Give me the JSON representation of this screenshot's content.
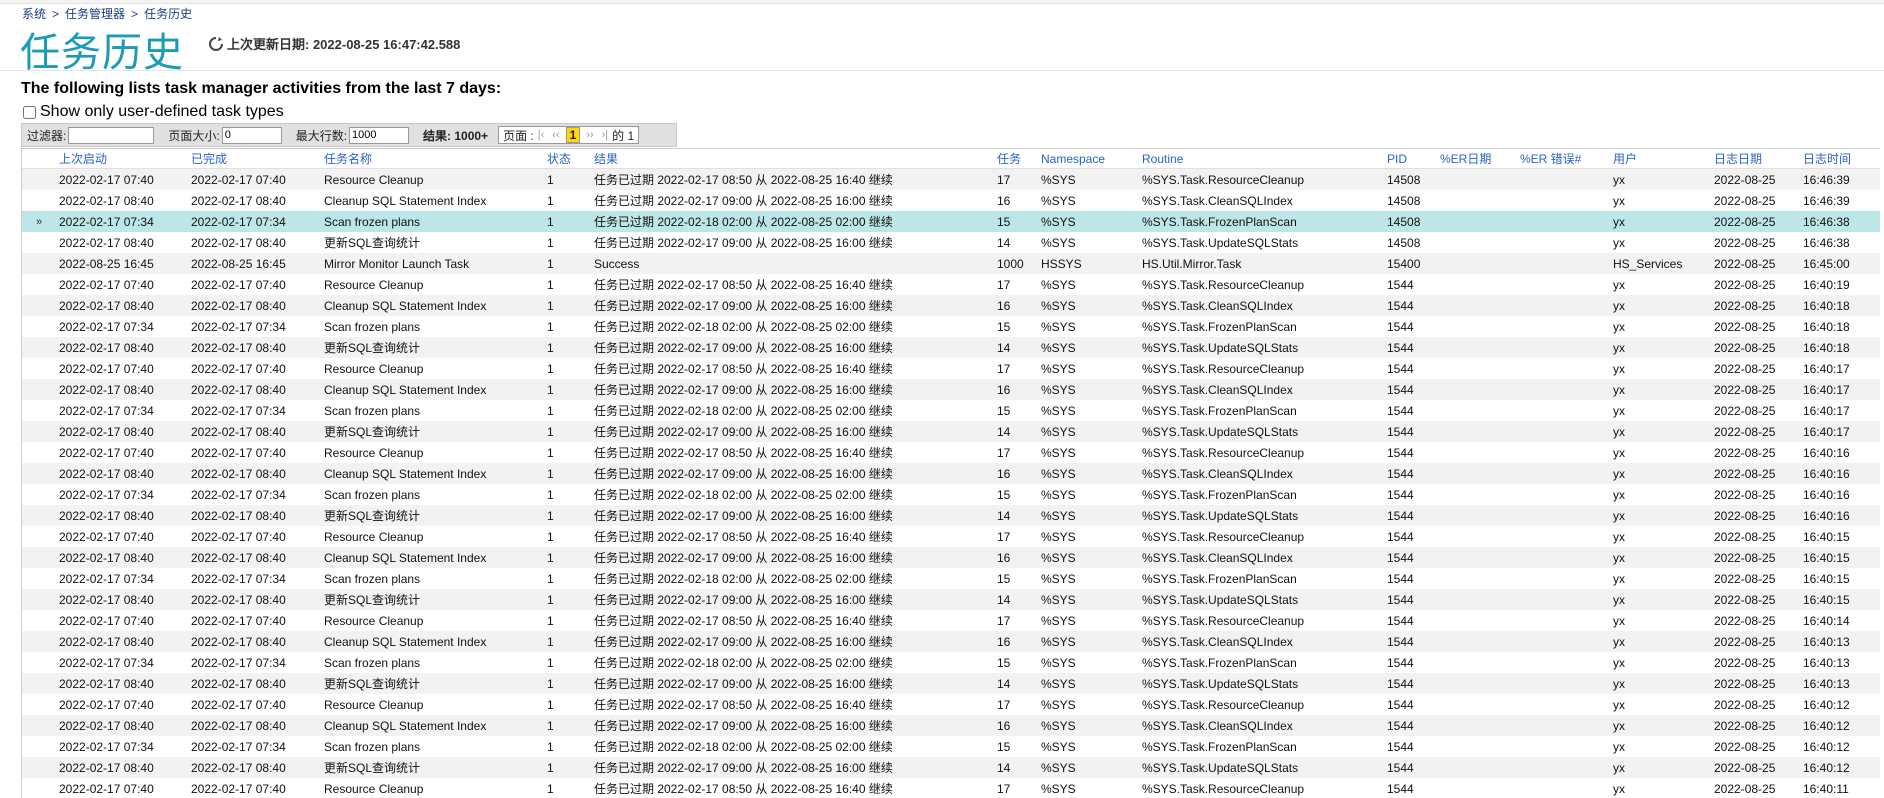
{
  "breadcrumb": {
    "system": "系统",
    "task_manager": "任务管理器",
    "current": "任务历史",
    "separator": ">"
  },
  "page_title": "任务历史",
  "refresh": {
    "label": "上次更新日期: 2022-08-25 16:47:42.588"
  },
  "intro": "The following lists task manager activities from the last 7 days:",
  "user_defined_checkbox": {
    "label": "Show only user-defined task types",
    "checked": false
  },
  "toolbar": {
    "filter_label": "过滤器:",
    "filter_value": "",
    "page_size_label": "页面大小:",
    "page_size_value": "0",
    "max_rows_label": "最大行数:",
    "max_rows_value": "1000",
    "results_label": "结果: 1000+",
    "page_label": "页面 :",
    "first": "|‹",
    "prev": "‹‹",
    "current_page": "1",
    "next": "››",
    "last": "›|",
    "of_total": "的 1"
  },
  "columns": [
    "上次启动",
    "已完成",
    "任务名称",
    "状态",
    "结果",
    "任务",
    "Namespace",
    "Routine",
    "PID",
    "%ER日期",
    "%ER 错误#",
    "用户",
    "日志日期",
    "日志时间"
  ],
  "selected_marker": "»",
  "rows": [
    [
      "2022-02-17 07:40",
      "2022-02-17 07:40",
      "Resource Cleanup",
      "1",
      "任务已过期 2022-02-17 08:50 从 2022-08-25 16:40 继续",
      "17",
      "%SYS",
      "%SYS.Task.ResourceCleanup",
      "14508",
      "",
      "",
      "yx",
      "2022-08-25",
      "16:46:39"
    ],
    [
      "2022-02-17 08:40",
      "2022-02-17 08:40",
      "Cleanup SQL Statement Index",
      "1",
      "任务已过期 2022-02-17 09:00 从 2022-08-25 16:00 继续",
      "16",
      "%SYS",
      "%SYS.Task.CleanSQLIndex",
      "14508",
      "",
      "",
      "yx",
      "2022-08-25",
      "16:46:39"
    ],
    [
      "2022-02-17 07:34",
      "2022-02-17 07:34",
      "Scan frozen plans",
      "1",
      "任务已过期 2022-02-18 02:00 从 2022-08-25 02:00 继续",
      "15",
      "%SYS",
      "%SYS.Task.FrozenPlanScan",
      "14508",
      "",
      "",
      "yx",
      "2022-08-25",
      "16:46:38"
    ],
    [
      "2022-02-17 08:40",
      "2022-02-17 08:40",
      "更新SQL查询统计",
      "1",
      "任务已过期 2022-02-17 09:00 从 2022-08-25 16:00 继续",
      "14",
      "%SYS",
      "%SYS.Task.UpdateSQLStats",
      "14508",
      "",
      "",
      "yx",
      "2022-08-25",
      "16:46:38"
    ],
    [
      "2022-08-25 16:45",
      "2022-08-25 16:45",
      "Mirror Monitor Launch Task",
      "1",
      "Success",
      "1000",
      "HSSYS",
      "HS.Util.Mirror.Task",
      "15400",
      "",
      "",
      "HS_Services",
      "2022-08-25",
      "16:45:00"
    ],
    [
      "2022-02-17 07:40",
      "2022-02-17 07:40",
      "Resource Cleanup",
      "1",
      "任务已过期 2022-02-17 08:50 从 2022-08-25 16:40 继续",
      "17",
      "%SYS",
      "%SYS.Task.ResourceCleanup",
      "1544",
      "",
      "",
      "yx",
      "2022-08-25",
      "16:40:19"
    ],
    [
      "2022-02-17 08:40",
      "2022-02-17 08:40",
      "Cleanup SQL Statement Index",
      "1",
      "任务已过期 2022-02-17 09:00 从 2022-08-25 16:00 继续",
      "16",
      "%SYS",
      "%SYS.Task.CleanSQLIndex",
      "1544",
      "",
      "",
      "yx",
      "2022-08-25",
      "16:40:18"
    ],
    [
      "2022-02-17 07:34",
      "2022-02-17 07:34",
      "Scan frozen plans",
      "1",
      "任务已过期 2022-02-18 02:00 从 2022-08-25 02:00 继续",
      "15",
      "%SYS",
      "%SYS.Task.FrozenPlanScan",
      "1544",
      "",
      "",
      "yx",
      "2022-08-25",
      "16:40:18"
    ],
    [
      "2022-02-17 08:40",
      "2022-02-17 08:40",
      "更新SQL查询统计",
      "1",
      "任务已过期 2022-02-17 09:00 从 2022-08-25 16:00 继续",
      "14",
      "%SYS",
      "%SYS.Task.UpdateSQLStats",
      "1544",
      "",
      "",
      "yx",
      "2022-08-25",
      "16:40:18"
    ],
    [
      "2022-02-17 07:40",
      "2022-02-17 07:40",
      "Resource Cleanup",
      "1",
      "任务已过期 2022-02-17 08:50 从 2022-08-25 16:40 继续",
      "17",
      "%SYS",
      "%SYS.Task.ResourceCleanup",
      "1544",
      "",
      "",
      "yx",
      "2022-08-25",
      "16:40:17"
    ],
    [
      "2022-02-17 08:40",
      "2022-02-17 08:40",
      "Cleanup SQL Statement Index",
      "1",
      "任务已过期 2022-02-17 09:00 从 2022-08-25 16:00 继续",
      "16",
      "%SYS",
      "%SYS.Task.CleanSQLIndex",
      "1544",
      "",
      "",
      "yx",
      "2022-08-25",
      "16:40:17"
    ],
    [
      "2022-02-17 07:34",
      "2022-02-17 07:34",
      "Scan frozen plans",
      "1",
      "任务已过期 2022-02-18 02:00 从 2022-08-25 02:00 继续",
      "15",
      "%SYS",
      "%SYS.Task.FrozenPlanScan",
      "1544",
      "",
      "",
      "yx",
      "2022-08-25",
      "16:40:17"
    ],
    [
      "2022-02-17 08:40",
      "2022-02-17 08:40",
      "更新SQL查询统计",
      "1",
      "任务已过期 2022-02-17 09:00 从 2022-08-25 16:00 继续",
      "14",
      "%SYS",
      "%SYS.Task.UpdateSQLStats",
      "1544",
      "",
      "",
      "yx",
      "2022-08-25",
      "16:40:17"
    ],
    [
      "2022-02-17 07:40",
      "2022-02-17 07:40",
      "Resource Cleanup",
      "1",
      "任务已过期 2022-02-17 08:50 从 2022-08-25 16:40 继续",
      "17",
      "%SYS",
      "%SYS.Task.ResourceCleanup",
      "1544",
      "",
      "",
      "yx",
      "2022-08-25",
      "16:40:16"
    ],
    [
      "2022-02-17 08:40",
      "2022-02-17 08:40",
      "Cleanup SQL Statement Index",
      "1",
      "任务已过期 2022-02-17 09:00 从 2022-08-25 16:00 继续",
      "16",
      "%SYS",
      "%SYS.Task.CleanSQLIndex",
      "1544",
      "",
      "",
      "yx",
      "2022-08-25",
      "16:40:16"
    ],
    [
      "2022-02-17 07:34",
      "2022-02-17 07:34",
      "Scan frozen plans",
      "1",
      "任务已过期 2022-02-18 02:00 从 2022-08-25 02:00 继续",
      "15",
      "%SYS",
      "%SYS.Task.FrozenPlanScan",
      "1544",
      "",
      "",
      "yx",
      "2022-08-25",
      "16:40:16"
    ],
    [
      "2022-02-17 08:40",
      "2022-02-17 08:40",
      "更新SQL查询统计",
      "1",
      "任务已过期 2022-02-17 09:00 从 2022-08-25 16:00 继续",
      "14",
      "%SYS",
      "%SYS.Task.UpdateSQLStats",
      "1544",
      "",
      "",
      "yx",
      "2022-08-25",
      "16:40:16"
    ],
    [
      "2022-02-17 07:40",
      "2022-02-17 07:40",
      "Resource Cleanup",
      "1",
      "任务已过期 2022-02-17 08:50 从 2022-08-25 16:40 继续",
      "17",
      "%SYS",
      "%SYS.Task.ResourceCleanup",
      "1544",
      "",
      "",
      "yx",
      "2022-08-25",
      "16:40:15"
    ],
    [
      "2022-02-17 08:40",
      "2022-02-17 08:40",
      "Cleanup SQL Statement Index",
      "1",
      "任务已过期 2022-02-17 09:00 从 2022-08-25 16:00 继续",
      "16",
      "%SYS",
      "%SYS.Task.CleanSQLIndex",
      "1544",
      "",
      "",
      "yx",
      "2022-08-25",
      "16:40:15"
    ],
    [
      "2022-02-17 07:34",
      "2022-02-17 07:34",
      "Scan frozen plans",
      "1",
      "任务已过期 2022-02-18 02:00 从 2022-08-25 02:00 继续",
      "15",
      "%SYS",
      "%SYS.Task.FrozenPlanScan",
      "1544",
      "",
      "",
      "yx",
      "2022-08-25",
      "16:40:15"
    ],
    [
      "2022-02-17 08:40",
      "2022-02-17 08:40",
      "更新SQL查询统计",
      "1",
      "任务已过期 2022-02-17 09:00 从 2022-08-25 16:00 继续",
      "14",
      "%SYS",
      "%SYS.Task.UpdateSQLStats",
      "1544",
      "",
      "",
      "yx",
      "2022-08-25",
      "16:40:15"
    ],
    [
      "2022-02-17 07:40",
      "2022-02-17 07:40",
      "Resource Cleanup",
      "1",
      "任务已过期 2022-02-17 08:50 从 2022-08-25 16:40 继续",
      "17",
      "%SYS",
      "%SYS.Task.ResourceCleanup",
      "1544",
      "",
      "",
      "yx",
      "2022-08-25",
      "16:40:14"
    ],
    [
      "2022-02-17 08:40",
      "2022-02-17 08:40",
      "Cleanup SQL Statement Index",
      "1",
      "任务已过期 2022-02-17 09:00 从 2022-08-25 16:00 继续",
      "16",
      "%SYS",
      "%SYS.Task.CleanSQLIndex",
      "1544",
      "",
      "",
      "yx",
      "2022-08-25",
      "16:40:13"
    ],
    [
      "2022-02-17 07:34",
      "2022-02-17 07:34",
      "Scan frozen plans",
      "1",
      "任务已过期 2022-02-18 02:00 从 2022-08-25 02:00 继续",
      "15",
      "%SYS",
      "%SYS.Task.FrozenPlanScan",
      "1544",
      "",
      "",
      "yx",
      "2022-08-25",
      "16:40:13"
    ],
    [
      "2022-02-17 08:40",
      "2022-02-17 08:40",
      "更新SQL查询统计",
      "1",
      "任务已过期 2022-02-17 09:00 从 2022-08-25 16:00 继续",
      "14",
      "%SYS",
      "%SYS.Task.UpdateSQLStats",
      "1544",
      "",
      "",
      "yx",
      "2022-08-25",
      "16:40:13"
    ],
    [
      "2022-02-17 07:40",
      "2022-02-17 07:40",
      "Resource Cleanup",
      "1",
      "任务已过期 2022-02-17 08:50 从 2022-08-25 16:40 继续",
      "17",
      "%SYS",
      "%SYS.Task.ResourceCleanup",
      "1544",
      "",
      "",
      "yx",
      "2022-08-25",
      "16:40:12"
    ],
    [
      "2022-02-17 08:40",
      "2022-02-17 08:40",
      "Cleanup SQL Statement Index",
      "1",
      "任务已过期 2022-02-17 09:00 从 2022-08-25 16:00 继续",
      "16",
      "%SYS",
      "%SYS.Task.CleanSQLIndex",
      "1544",
      "",
      "",
      "yx",
      "2022-08-25",
      "16:40:12"
    ],
    [
      "2022-02-17 07:34",
      "2022-02-17 07:34",
      "Scan frozen plans",
      "1",
      "任务已过期 2022-02-18 02:00 从 2022-08-25 02:00 继续",
      "15",
      "%SYS",
      "%SYS.Task.FrozenPlanScan",
      "1544",
      "",
      "",
      "yx",
      "2022-08-25",
      "16:40:12"
    ],
    [
      "2022-02-17 08:40",
      "2022-02-17 08:40",
      "更新SQL查询统计",
      "1",
      "任务已过期 2022-02-17 09:00 从 2022-08-25 16:00 继续",
      "14",
      "%SYS",
      "%SYS.Task.UpdateSQLStats",
      "1544",
      "",
      "",
      "yx",
      "2022-08-25",
      "16:40:12"
    ],
    [
      "2022-02-17 07:40",
      "2022-02-17 07:40",
      "Resource Cleanup",
      "1",
      "任务已过期 2022-02-17 08:50 从 2022-08-25 16:40 继续",
      "17",
      "%SYS",
      "%SYS.Task.ResourceCleanup",
      "1544",
      "",
      "",
      "yx",
      "2022-08-25",
      "16:40:11"
    ]
  ],
  "selected_row": 2
}
